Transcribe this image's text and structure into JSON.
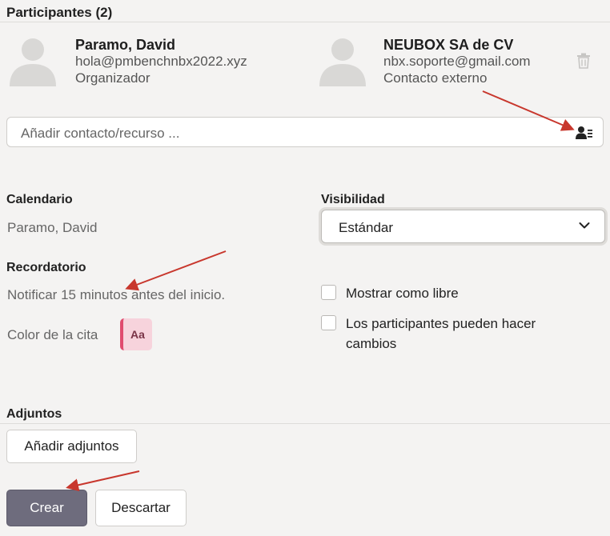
{
  "participants": {
    "title": "Participantes (2)",
    "list": [
      {
        "name": "Paramo, David",
        "email": "hola@pmbenchnbx2022.xyz",
        "role": "Organizador"
      },
      {
        "name": "NEUBOX SA de CV",
        "email": "nbx.soporte@gmail.com",
        "role": "Contacto externo"
      }
    ],
    "add_placeholder": "Añadir contacto/recurso ..."
  },
  "calendar": {
    "label": "Calendario",
    "value": "Paramo, David"
  },
  "visibility": {
    "label": "Visibilidad",
    "selected": "Estándar"
  },
  "reminder": {
    "label": "Recordatorio",
    "value": "Notificar 15 minutos antes del inicio."
  },
  "color": {
    "label": "Color de la cita",
    "chip_text": "Aa"
  },
  "options": {
    "show_as_free": "Mostrar como libre",
    "participants_can_modify_line1": "Los participantes pueden hacer",
    "participants_can_modify_line2": "cambios"
  },
  "attachments": {
    "label": "Adjuntos",
    "add_button": "Añadir adjuntos"
  },
  "actions": {
    "create": "Crear",
    "discard": "Descartar"
  },
  "colors": {
    "primary_button": "#6e6c7d",
    "annotation_arrow": "#c8372d",
    "color_chip_bg": "#f7d3dc",
    "color_chip_border": "#e04b6e"
  }
}
